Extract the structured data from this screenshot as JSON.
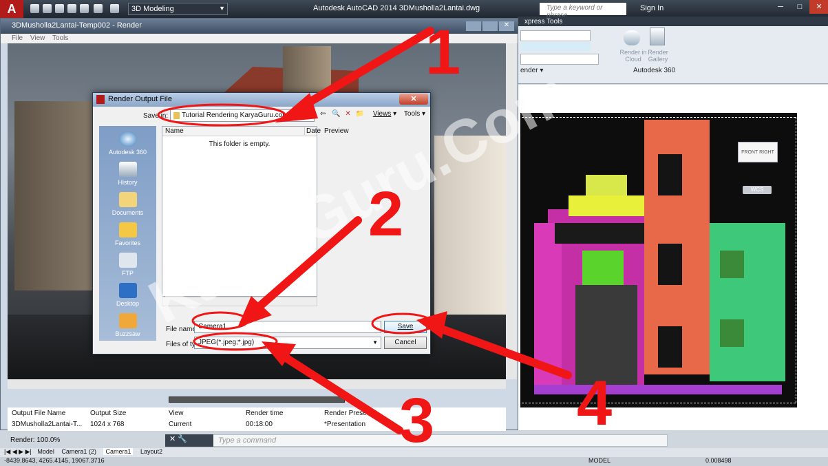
{
  "app": {
    "workspace": "3D Modeling",
    "title": "Autodesk AutoCAD 2014   3DMusholla2Lantai.dwg",
    "search_placeholder": "Type a keyword or phrase",
    "sign_in": "Sign In"
  },
  "ribbon": {
    "express_tools": "xpress Tools",
    "render_panel": "ender ▾",
    "render_in_cloud": "Render in Cloud",
    "render_gallery": "Render Gallery",
    "autodesk_360": "Autodesk 360"
  },
  "render_window": {
    "title": "3DMusholla2Lantai-Temp002 - Render",
    "menu": [
      "File",
      "View",
      "Tools"
    ],
    "list_headers": [
      "Output File Name",
      "Output Size",
      "View",
      "Render time",
      "Render Preset"
    ],
    "list_row": [
      "3DMusholla2Lantai-T...",
      "1024 x 768",
      "Current",
      "00:18:00",
      "*Presentation"
    ],
    "status": "Render: 100.0%"
  },
  "dialog": {
    "title": "Render Output File",
    "save_in_label": "Save in:",
    "save_in_value": "Tutorial Rendering KaryaGuru.com",
    "views": "Views",
    "tools": "Tools",
    "places": [
      "Autodesk 360",
      "History",
      "Documents",
      "Favorites",
      "FTP",
      "Desktop",
      "Buzzsaw"
    ],
    "col_name": "Name",
    "col_date": "Date",
    "empty": "This folder is empty.",
    "preview": "Preview",
    "file_name_label": "File name:",
    "file_name": "Camera1",
    "file_type_label": "Files of type:",
    "file_type": "JPEG(*.jpeg;*.jpg)",
    "save": "Save",
    "cancel": "Cancel"
  },
  "viewport": {
    "viewcube_front": "FRONT",
    "viewcube_right": "RIGHT",
    "wcs": "WCS"
  },
  "command_line": {
    "placeholder": "Type a command"
  },
  "layout_tabs": [
    "Model",
    "Camera1 (2)",
    "Camera1",
    "Layout2"
  ],
  "status_bar": {
    "coords": "-8439.8643, 4265.4145, 19067.3716",
    "model": "MODEL",
    "scale": "0.008498"
  },
  "annotations": {
    "numbers": [
      "1",
      "2",
      "3",
      "4"
    ],
    "watermark": "KaryaGuru.Com",
    "color": "#f01616"
  }
}
